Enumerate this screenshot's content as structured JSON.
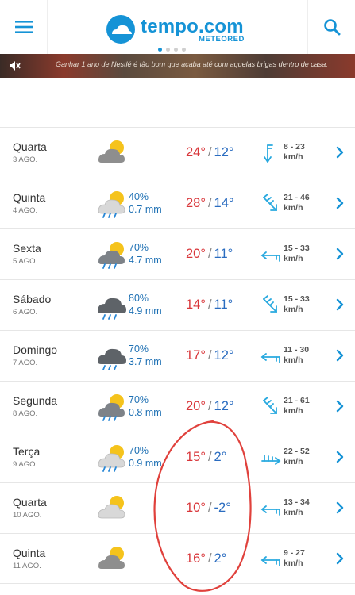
{
  "header": {
    "logo_text": "tempo.com",
    "logo_sub": "METEORED",
    "menu_icon": "hamburger-icon",
    "search_icon": "search-icon",
    "brand_color": "#1593d6",
    "carousel_pages": 4,
    "carousel_active": 1
  },
  "ad": {
    "text": "Ganhar 1 ano de Nestlé é tão bom que acaba até com aquelas brigas dentro de casa.",
    "icon": "mute-icon"
  },
  "forecast": [
    {
      "day": "Quarta",
      "date": "3 AGO.",
      "icon": "cloudy-sun",
      "prob": "",
      "amount": "",
      "tmax": "24°",
      "tmin": "12°",
      "wind_dir": "wind-s-icon",
      "wind": "8 - 23",
      "unit": "km/h"
    },
    {
      "day": "Quinta",
      "date": "4 AGO.",
      "icon": "sun-cloud-rain",
      "prob": "40%",
      "amount": "0.7 mm",
      "tmax": "28°",
      "tmin": "14°",
      "wind_dir": "wind-se-icon",
      "wind": "21 - 46",
      "unit": "km/h"
    },
    {
      "day": "Sexta",
      "date": "5 AGO.",
      "icon": "sun-darkcloud-rain",
      "prob": "70%",
      "amount": "4.7 mm",
      "tmax": "20°",
      "tmin": "11°",
      "wind_dir": "wind-w-icon",
      "wind": "15 - 33",
      "unit": "km/h"
    },
    {
      "day": "Sábado",
      "date": "6 AGO.",
      "icon": "darkcloud-rain",
      "prob": "80%",
      "amount": "4.9 mm",
      "tmax": "14°",
      "tmin": "11°",
      "wind_dir": "wind-se-icon",
      "wind": "15 - 33",
      "unit": "km/h"
    },
    {
      "day": "Domingo",
      "date": "7 AGO.",
      "icon": "darkcloud-rain",
      "prob": "70%",
      "amount": "3.7 mm",
      "tmax": "17°",
      "tmin": "12°",
      "wind_dir": "wind-w-icon",
      "wind": "11 - 30",
      "unit": "km/h"
    },
    {
      "day": "Segunda",
      "date": "8 AGO.",
      "icon": "sun-darkcloud-rain",
      "prob": "70%",
      "amount": "0.8 mm",
      "tmax": "20°",
      "tmin": "12°",
      "wind_dir": "wind-se-icon",
      "wind": "21 - 61",
      "unit": "km/h"
    },
    {
      "day": "Terça",
      "date": "9 AGO.",
      "icon": "sun-cloud-rain",
      "prob": "70%",
      "amount": "0.9 mm",
      "tmax": "15°",
      "tmin": "2°",
      "wind_dir": "wind-e-icon",
      "wind": "22 - 52",
      "unit": "km/h"
    },
    {
      "day": "Quarta",
      "date": "10 AGO.",
      "icon": "sun-cloud",
      "prob": "",
      "amount": "",
      "tmax": "10°",
      "tmin": "-2°",
      "wind_dir": "wind-w-icon",
      "wind": "13 - 34",
      "unit": "km/h"
    },
    {
      "day": "Quinta",
      "date": "11 AGO.",
      "icon": "cloudy-sun",
      "prob": "",
      "amount": "",
      "tmax": "16°",
      "tmin": "2°",
      "wind_dir": "wind-w-icon",
      "wind": "9 - 27",
      "unit": "km/h"
    }
  ],
  "colors": {
    "tmax": "#d9373b",
    "tmin": "#2a6cc0",
    "precip": "#1c6fb3",
    "wind_icon": "#29a9df",
    "annotation": "#e0413c"
  }
}
